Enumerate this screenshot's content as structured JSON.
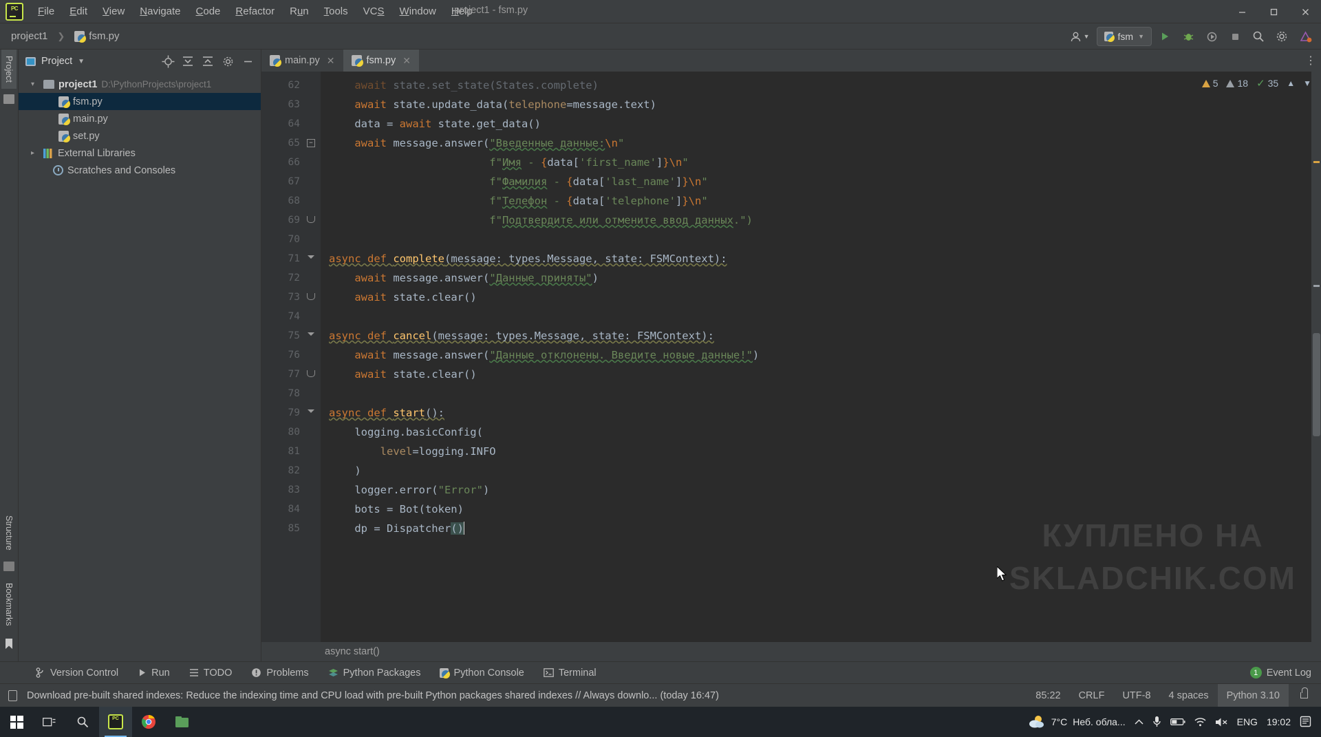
{
  "window": {
    "title": "project1 - fsm.py",
    "minimize": "─",
    "maximize": "☐",
    "close": "✕"
  },
  "menubar": {
    "items": [
      {
        "label": "File",
        "mnemonic": "F"
      },
      {
        "label": "Edit",
        "mnemonic": "E"
      },
      {
        "label": "View",
        "mnemonic": "V"
      },
      {
        "label": "Navigate",
        "mnemonic": "N"
      },
      {
        "label": "Code",
        "mnemonic": "C"
      },
      {
        "label": "Refactor",
        "mnemonic": "R"
      },
      {
        "label": "Run",
        "mnemonic": "R"
      },
      {
        "label": "Tools",
        "mnemonic": "T"
      },
      {
        "label": "VCS",
        "mnemonic": "S"
      },
      {
        "label": "Window",
        "mnemonic": "W"
      },
      {
        "label": "Help",
        "mnemonic": "H"
      }
    ]
  },
  "navbar": {
    "breadcrumb": [
      "project1",
      "fsm.py"
    ],
    "run_config": "fsm",
    "icons": [
      "user-icon",
      "run-icon",
      "debug-icon",
      "coverage-icon",
      "stop-icon",
      "search-icon",
      "settings-icon",
      "updates-icon"
    ]
  },
  "rail": {
    "left_top": "Project",
    "left_items": [
      "Structure",
      "Bookmarks"
    ]
  },
  "project_panel": {
    "title": "Project",
    "header_icons": [
      "locate-icon",
      "expand-all-icon",
      "collapse-all-icon",
      "settings-icon",
      "hide-icon"
    ],
    "tree": [
      {
        "label": "project1",
        "path": "D:\\PythonProjects\\project1",
        "kind": "root",
        "expanded": true,
        "selected": false
      },
      {
        "label": "fsm.py",
        "kind": "python-file",
        "selected": true
      },
      {
        "label": "main.py",
        "kind": "python-file",
        "selected": false
      },
      {
        "label": "set.py",
        "kind": "python-file",
        "selected": false
      },
      {
        "label": "External Libraries",
        "kind": "libraries",
        "expanded": false,
        "selected": false
      },
      {
        "label": "Scratches and Consoles",
        "kind": "scratches",
        "selected": false
      }
    ]
  },
  "editor": {
    "tabs": [
      {
        "label": "main.py",
        "active": false
      },
      {
        "label": "fsm.py",
        "active": true
      }
    ],
    "inspections": {
      "warnings": "5",
      "weak_warnings": "18",
      "ok": "35"
    },
    "breadcrumb": "async start()",
    "first_line": 62,
    "lines": [
      {
        "n": 62,
        "fold": "",
        "text": "    await state.set_state(States.complete)"
      },
      {
        "n": 63,
        "fold": "",
        "text": "    await state.update_data(telephone=message.text)"
      },
      {
        "n": 64,
        "fold": "",
        "text": "    data = await state.get_data()"
      },
      {
        "n": 65,
        "fold": "minus-box",
        "text": "    await message.answer(\"Введенные данные:\\n\""
      },
      {
        "n": 66,
        "fold": "",
        "text": "                         f\"Имя - {data['first_name']}\\n\""
      },
      {
        "n": 67,
        "fold": "",
        "text": "                         f\"Фамилия - {data['last_name']}\\n\""
      },
      {
        "n": 68,
        "fold": "",
        "text": "                         f\"Телефон - {data['telephone']}\\n\""
      },
      {
        "n": 69,
        "fold": "end",
        "text": "                         f\"Подтвердите или отмените ввод данных.\")"
      },
      {
        "n": 70,
        "fold": "",
        "text": ""
      },
      {
        "n": 71,
        "fold": "tri",
        "text": "async def complete(message: types.Message, state: FSMContext):"
      },
      {
        "n": 72,
        "fold": "",
        "text": "    await message.answer(\"Данные приняты\")"
      },
      {
        "n": 73,
        "fold": "end",
        "text": "    await state.clear()"
      },
      {
        "n": 74,
        "fold": "",
        "text": ""
      },
      {
        "n": 75,
        "fold": "tri",
        "text": "async def cancel(message: types.Message, state: FSMContext):"
      },
      {
        "n": 76,
        "fold": "",
        "text": "    await message.answer(\"Данные отклонены. Введите новые данные!\")"
      },
      {
        "n": 77,
        "fold": "end",
        "text": "    await state.clear()"
      },
      {
        "n": 78,
        "fold": "",
        "text": ""
      },
      {
        "n": 79,
        "fold": "tri",
        "text": "async def start():"
      },
      {
        "n": 80,
        "fold": "",
        "text": "    logging.basicConfig("
      },
      {
        "n": 81,
        "fold": "",
        "text": "        level=logging.INFO"
      },
      {
        "n": 82,
        "fold": "",
        "text": "    )"
      },
      {
        "n": 83,
        "fold": "",
        "text": "    logger.error(\"Error\")"
      },
      {
        "n": 84,
        "fold": "",
        "text": "    bots = Bot(token)"
      },
      {
        "n": 85,
        "fold": "",
        "text": "    dp = Dispatcher()"
      }
    ]
  },
  "tool_window_bar": {
    "items": [
      {
        "label": "Version Control",
        "icon": "branch-icon"
      },
      {
        "label": "Run",
        "icon": "play-icon"
      },
      {
        "label": "TODO",
        "icon": "list-icon"
      },
      {
        "label": "Problems",
        "icon": "warning-circle-icon"
      },
      {
        "label": "Python Packages",
        "icon": "packages-icon"
      },
      {
        "label": "Python Console",
        "icon": "python-icon"
      },
      {
        "label": "Terminal",
        "icon": "terminal-icon"
      }
    ],
    "event_log": {
      "label": "Event Log",
      "count": "1"
    }
  },
  "statusbar": {
    "message": "Download pre-built shared indexes: Reduce the indexing time and CPU load with pre-built Python packages shared indexes // Always downlo... (today 16:47)",
    "caret_position": "85:22",
    "line_separator": "CRLF",
    "encoding": "UTF-8",
    "indent": "4 spaces",
    "interpreter": "Python 3.10",
    "lock": "read-only-toggle"
  },
  "taskbar": {
    "apps": [
      "start-button",
      "task-view",
      "search",
      "pycharm",
      "chrome",
      "explorer"
    ],
    "weather_temp": "7°C",
    "weather_desc": "Неб. обла...",
    "language": "ENG",
    "clock": "19:02",
    "tray_icons": [
      "chevron-up-icon",
      "microphone-icon",
      "battery-icon",
      "wifi-icon",
      "volume-muted-icon",
      "notifications-icon"
    ]
  },
  "watermark": {
    "line1": "КУПЛЕНО НА",
    "line2": "SKLADCHIK.COM"
  },
  "colors": {
    "accent": "#4b6eaf",
    "editor_bg": "#2b2b2b",
    "panel_bg": "#3c3f41",
    "gutter_bg": "#313335",
    "selection": "#0d293e",
    "string": "#6a8759",
    "keyword": "#cc7832",
    "function": "#ffc66d",
    "warning": "#d9a343",
    "ok": "#5a9e5a"
  }
}
